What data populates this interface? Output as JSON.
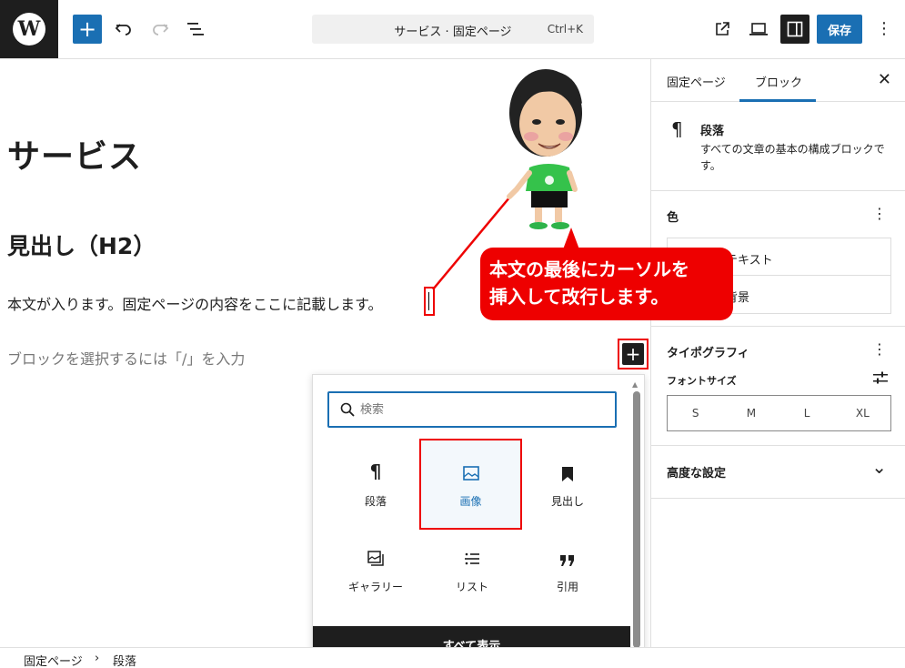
{
  "topbar": {
    "logo_glyph": "W",
    "add_glyph": "+",
    "command_title": "サービス · 固定ページ",
    "command_shortcut": "Ctrl+K",
    "save_label": "保存",
    "more_glyph": "⋮"
  },
  "editor": {
    "post_title": "サービス",
    "heading": "見出し（H2）",
    "paragraph": "本文が入ります。固定ページの内容をここに記載します。",
    "placeholder": "ブロックを選択するには「/」を入力",
    "inline_add_glyph": "+"
  },
  "inserter": {
    "search_placeholder": "検索",
    "blocks": [
      {
        "label": "段落",
        "icon": "paragraph-icon"
      },
      {
        "label": "画像",
        "icon": "image-icon"
      },
      {
        "label": "見出し",
        "icon": "heading-icon"
      },
      {
        "label": "ギャラリー",
        "icon": "gallery-icon"
      },
      {
        "label": "リスト",
        "icon": "list-icon"
      },
      {
        "label": "引用",
        "icon": "quote-icon"
      }
    ],
    "show_all_label": "すべて表示"
  },
  "breadcrumb": {
    "items": [
      "固定ページ",
      "段落"
    ],
    "separator": "›"
  },
  "sidebar": {
    "tabs": [
      "固定ページ",
      "ブロック"
    ],
    "close_glyph": "✕",
    "block_title": "段落",
    "block_desc": "すべての文章の基本の構成ブロックです。",
    "pilcrow_glyph": "¶",
    "color_label": "色",
    "color_rows": [
      "テキスト",
      "背景"
    ],
    "typography_label": "タイポグラフィ",
    "font_size_label": "フォントサイズ",
    "font_sizes": [
      "S",
      "M",
      "L",
      "XL"
    ],
    "advanced_label": "高度な設定",
    "dots_glyph": "⋮",
    "chevron_glyph": "⌄"
  },
  "annotation": {
    "callout_line1": "本文の最後にカーソルを",
    "callout_line2": "挿入して改行します。"
  },
  "colors": {
    "accent": "#1a6fb3",
    "dark": "#1e1e1e",
    "highlight": "#e00000"
  }
}
